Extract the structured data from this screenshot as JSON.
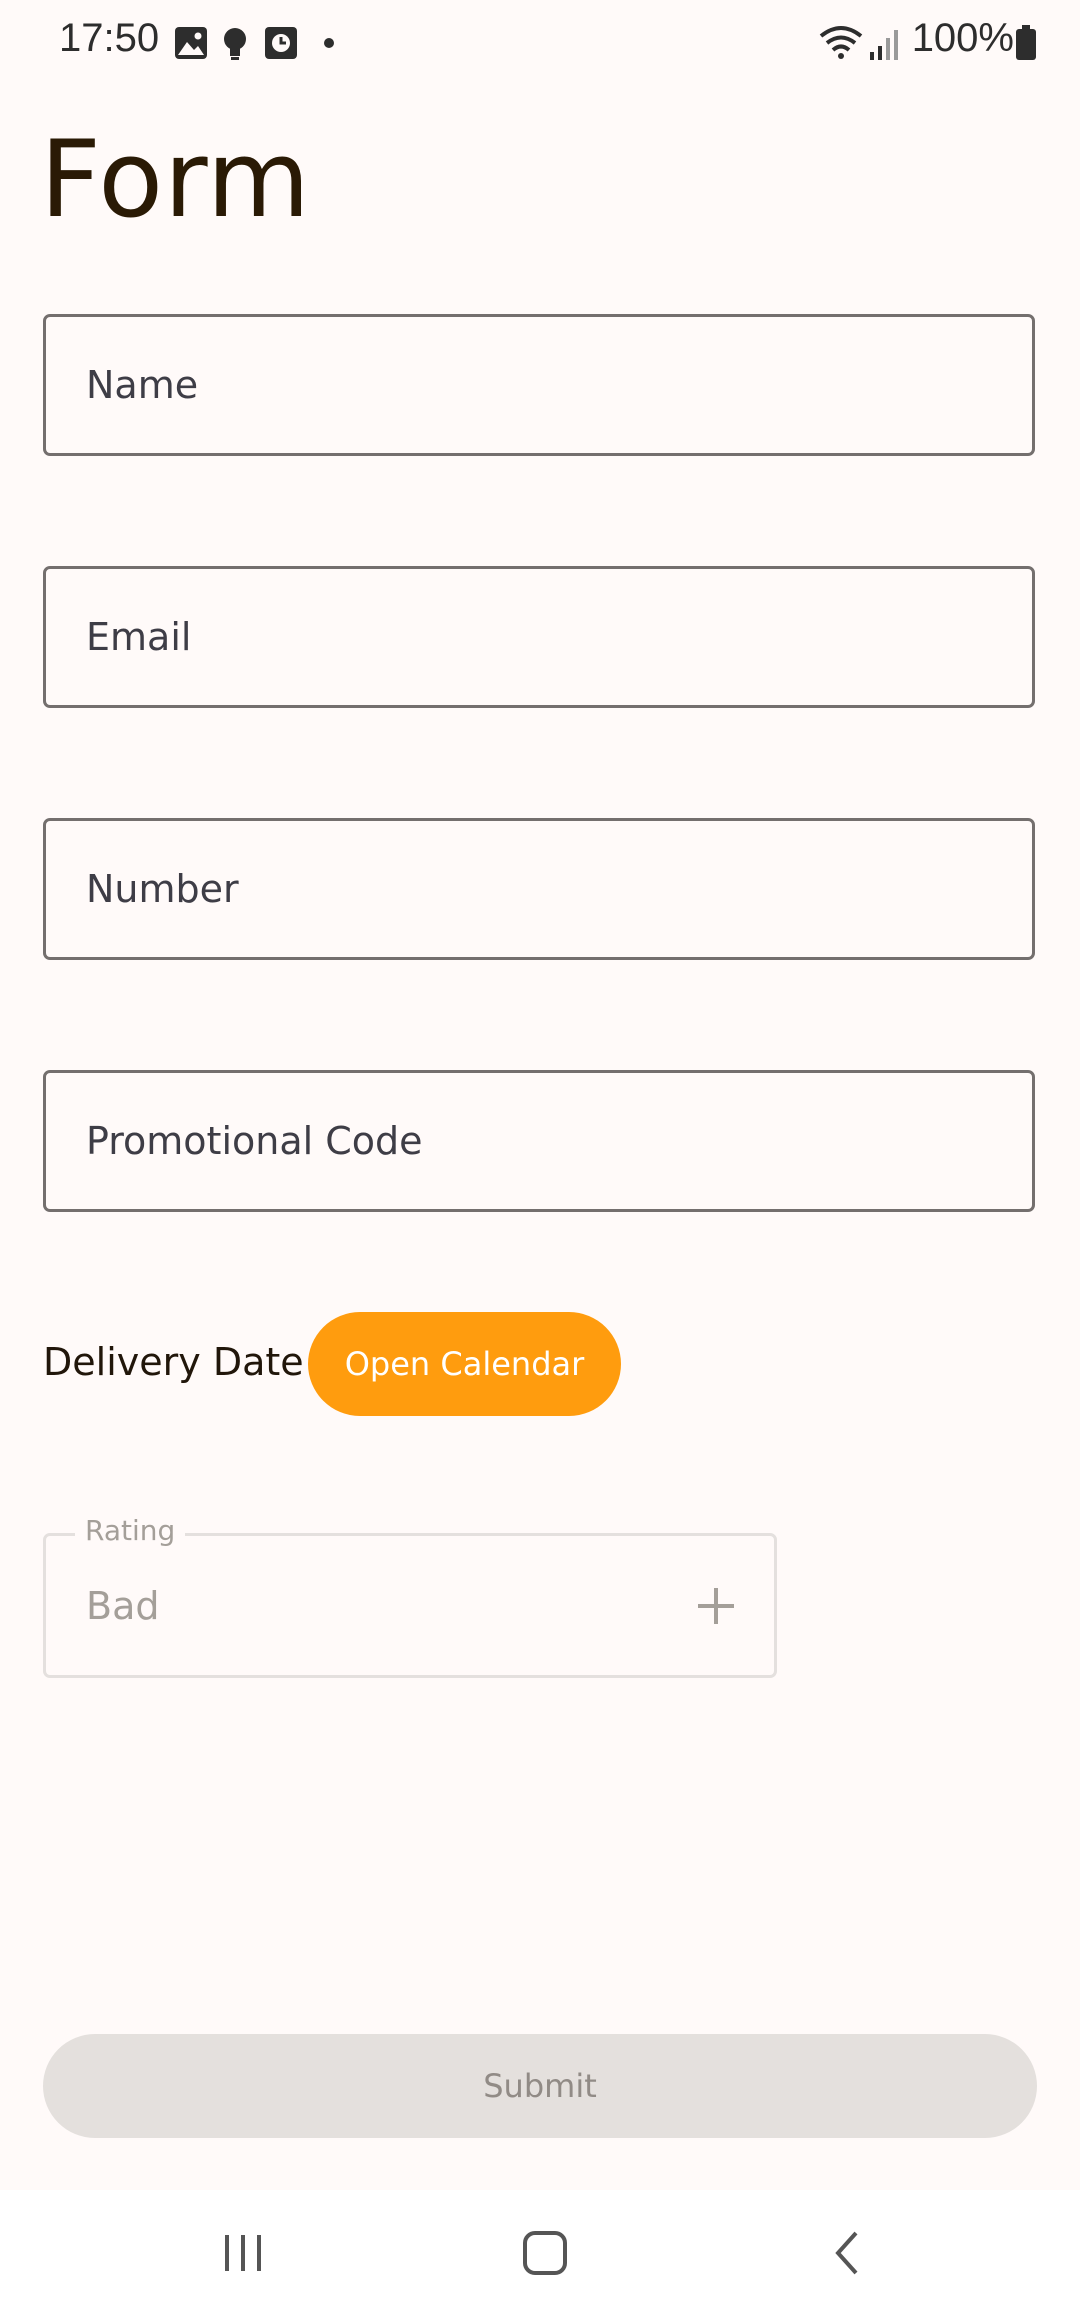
{
  "status_bar": {
    "time": "17:50",
    "battery": "100%",
    "left_icons": [
      "gallery-icon",
      "bulb-icon",
      "clock-app-icon",
      "dot-icon"
    ],
    "right_icons": [
      "wifi-icon",
      "signal-icon",
      "battery-icon"
    ]
  },
  "page": {
    "title": "Form"
  },
  "fields": {
    "name_label": "Name",
    "email_label": "Email",
    "number_label": "Number",
    "promo_label": "Promotional Code"
  },
  "delivery": {
    "label": "Delivery Date",
    "button_label": "Open Calendar"
  },
  "rating": {
    "legend": "Rating",
    "value": "Bad"
  },
  "submit": {
    "label": "Submit"
  },
  "colors": {
    "accent": "#ff9c0e",
    "background": "#fffaf9",
    "title": "#2a1a05",
    "disabled_button": "#e4e0dd"
  },
  "nav_bar": {
    "buttons": [
      "recents-icon",
      "home-icon",
      "back-icon"
    ]
  }
}
